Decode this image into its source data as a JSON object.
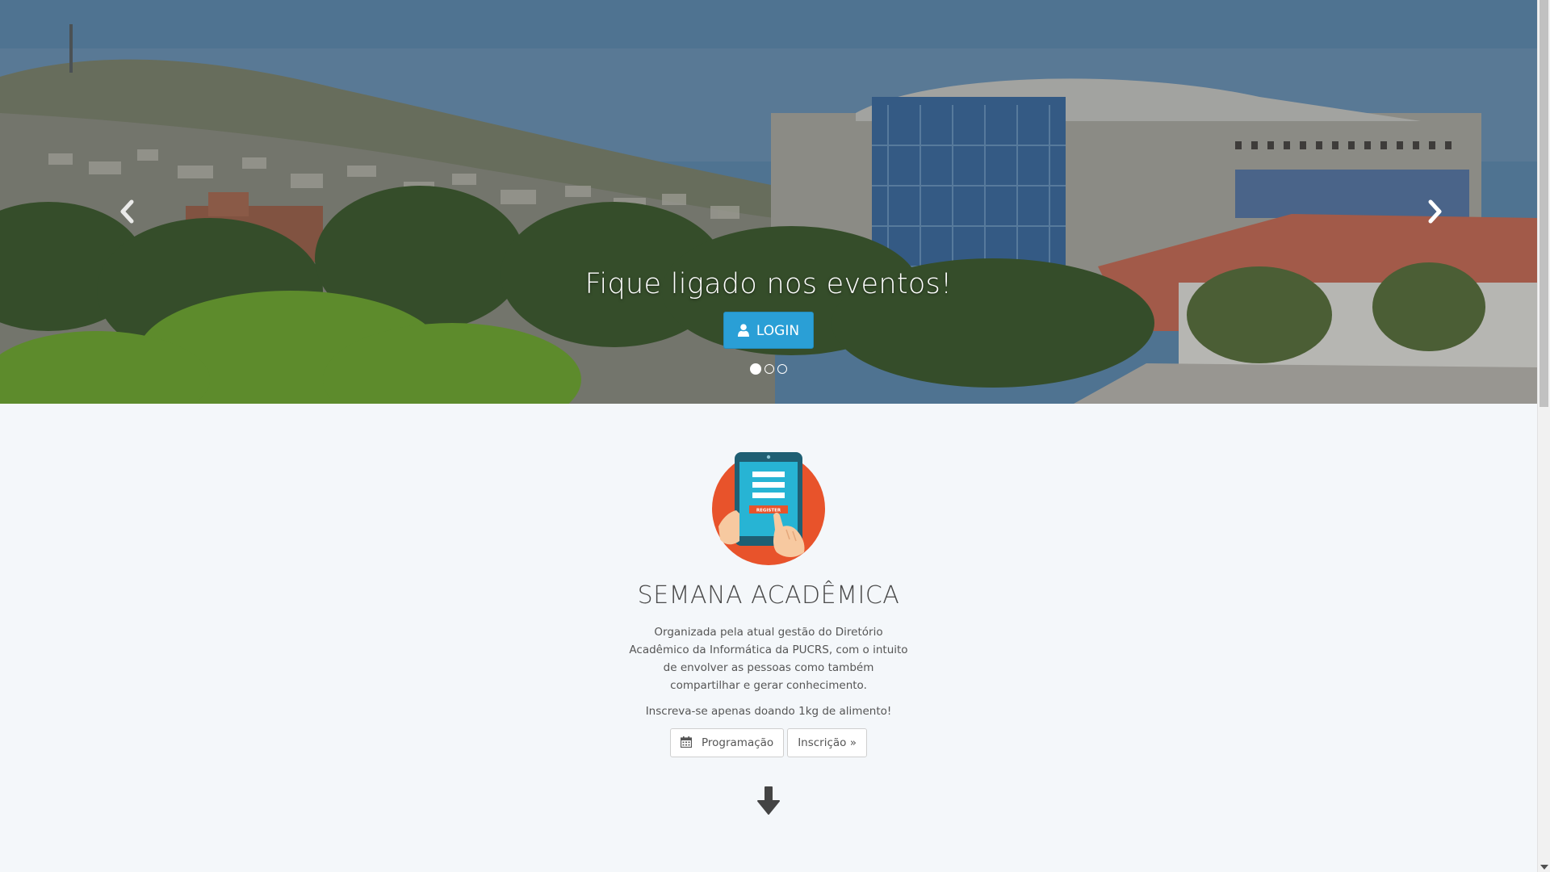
{
  "carousel": {
    "caption": "Fique ligado nos eventos!",
    "login_label": "LOGIN",
    "login_icon": "user-icon",
    "indicators": 3,
    "active_indicator": 1,
    "prev_icon": "chevron-left-icon",
    "next_icon": "chevron-right-icon"
  },
  "main": {
    "title": "SEMANA ACADÊMICA",
    "description": "Organizada pela atual gestão do Diretório Acadêmico da Informática da PUCRS, com o intuito de envolver as pessoas como também compartilhar e gerar conhecimento.",
    "cta": "Inscreva-se apenas doando 1kg de alimento!",
    "illustration_label": "REGISTER",
    "buttons": {
      "schedule_label": "Programação",
      "schedule_icon": "calendar-icon",
      "signup_label": "Inscrição »"
    },
    "scroll_icon": "arrow-down-icon"
  },
  "colors": {
    "primary": "#2a9fd6",
    "background": "#f4f7fa",
    "illustration_circle": "#e8532b",
    "illustration_tablet": "#1f5f73",
    "illustration_screen": "#27b4d4"
  }
}
